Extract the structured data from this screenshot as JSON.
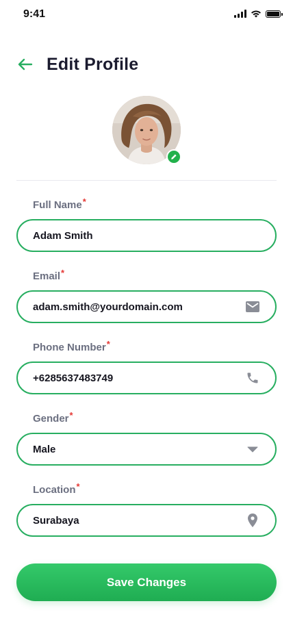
{
  "status_bar": {
    "time": "9:41"
  },
  "header": {
    "title": "Edit Profile",
    "back_icon": "arrow-left-icon"
  },
  "profile": {
    "avatar_alt": "profile photo",
    "edit_icon": "pencil-icon"
  },
  "form": {
    "full_name": {
      "label": "Full Name",
      "required": "*",
      "value": "Adam Smith"
    },
    "email": {
      "label": "Email",
      "required": "*",
      "value": "adam.smith@yourdomain.com",
      "icon": "mail-icon"
    },
    "phone": {
      "label": "Phone Number",
      "required": "*",
      "value": "+6285637483749",
      "icon": "phone-icon"
    },
    "gender": {
      "label": "Gender",
      "required": "*",
      "value": "Male",
      "icon": "caret-down-icon"
    },
    "location": {
      "label": "Location",
      "required": "*",
      "value": "Surabaya",
      "icon": "map-pin-icon"
    }
  },
  "actions": {
    "save_label": "Save Changes"
  },
  "colors": {
    "accent": "#27ae60",
    "button": "#22b14c",
    "required": "#e53935",
    "label": "#6b6f80",
    "icon": "#8a8d96"
  }
}
